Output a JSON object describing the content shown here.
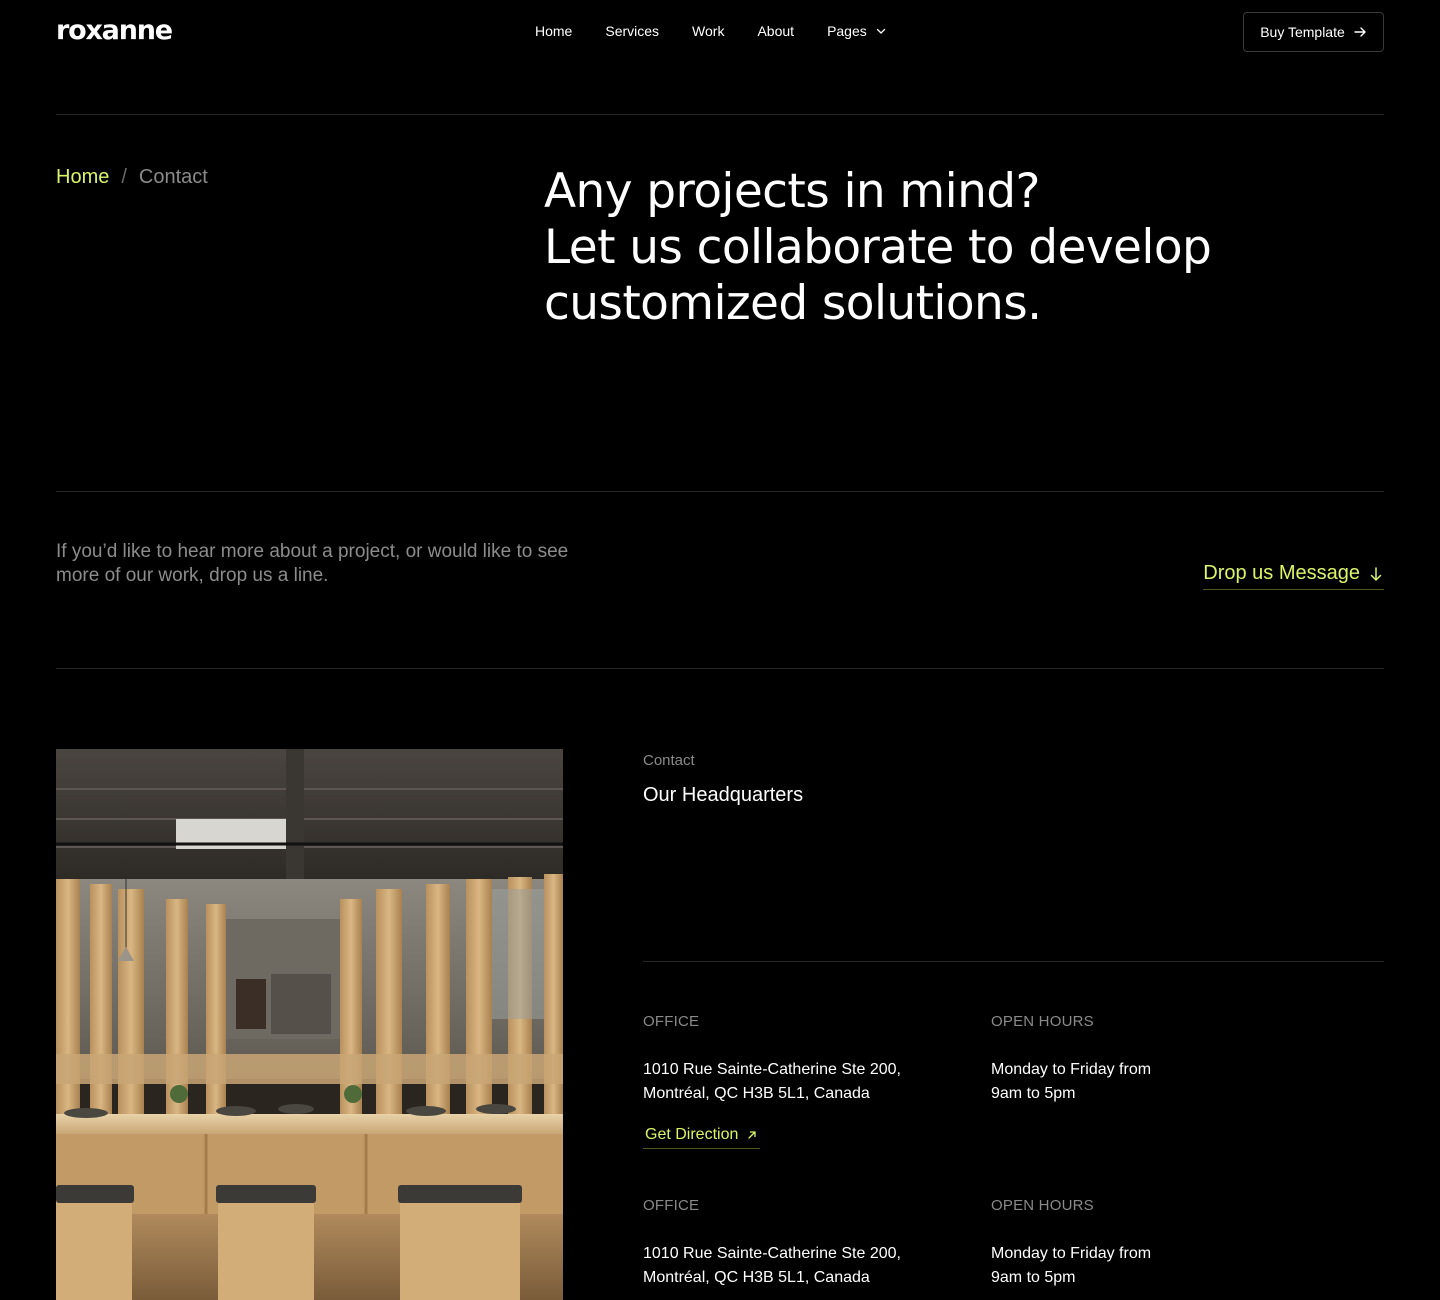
{
  "header": {
    "logo": "roxanne",
    "nav": [
      {
        "label": "Home"
      },
      {
        "label": "Services"
      },
      {
        "label": "Work"
      },
      {
        "label": "About"
      },
      {
        "label": "Pages",
        "icon": "chevron-down-icon"
      }
    ],
    "buy_button": {
      "label": "Buy Template",
      "icon": "arrow-right-icon"
    }
  },
  "breadcrumb": {
    "home": "Home",
    "separator": "/",
    "current": "Contact"
  },
  "hero": {
    "lines": [
      "Any projects in mind?",
      "Let us collaborate to develop",
      "customized solutions."
    ]
  },
  "intro": {
    "text": "If you’d like to hear more about a project, or would like to see more of our work, drop us a line.",
    "cta_label": "Drop us Message",
    "cta_icon": "arrow-down-icon"
  },
  "contact": {
    "label": "Contact",
    "title": "Our Headquarters",
    "blocks": [
      {
        "office_head": "OFFICE",
        "address_line1": "1010 Rue Sainte-Catherine Ste 200,",
        "address_line2": "Montréal, QC H3B 5L1, Canada",
        "direction_label": "Get Direction",
        "hours_head": "OPEN HOURS",
        "hours_line1": "Monday to Friday from",
        "hours_line2": "9am to 5pm"
      },
      {
        "office_head": "OFFICE",
        "address_line1": "1010 Rue Sainte-Catherine Ste 200,",
        "address_line2": "Montréal, QC H3B 5L1, Canada",
        "hours_head": "OPEN HOURS",
        "hours_line1": "Monday to Friday from",
        "hours_line2": "9am to 5pm"
      }
    ]
  },
  "colors": {
    "background": "#000000",
    "accent": "#d9f56a",
    "muted_text": "#8a8a8a",
    "divider": "#262626"
  }
}
